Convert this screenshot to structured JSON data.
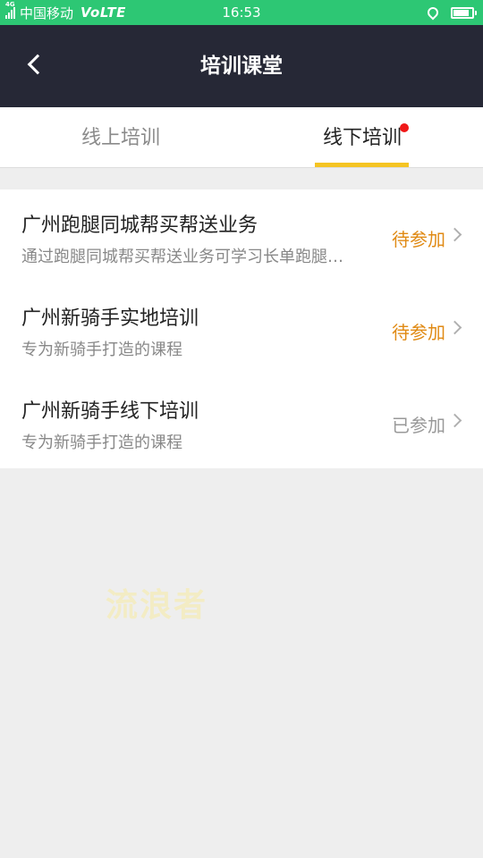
{
  "status_bar": {
    "network_tag": "4G",
    "carrier": "中国移动",
    "volte": "VoLTE",
    "time": "16:53",
    "battery_level": 0.85
  },
  "header": {
    "title": "培训课堂"
  },
  "tabs": [
    {
      "label": "线上培训",
      "active": false
    },
    {
      "label": "线下培训",
      "active": true,
      "has_dot": true
    }
  ],
  "courses": [
    {
      "title": "广州跑腿同城帮买帮送业务",
      "desc": "通过跑腿同城帮买帮送业务可学习长单跑腿相关知识",
      "status": "待参加",
      "status_type": "pending"
    },
    {
      "title": "广州新骑手实地培训",
      "desc": "专为新骑手打造的课程",
      "status": "待参加",
      "status_type": "pending"
    },
    {
      "title": "广州新骑手线下培训",
      "desc": "专为新骑手打造的课程",
      "status": "已参加",
      "status_type": "done"
    }
  ],
  "watermark": "流浪者",
  "colors": {
    "status_bar": "#2dc774",
    "header": "#262836",
    "tab_underline": "#f5c423",
    "pending": "#e08a14",
    "done": "#999999",
    "dot": "#f01818"
  }
}
